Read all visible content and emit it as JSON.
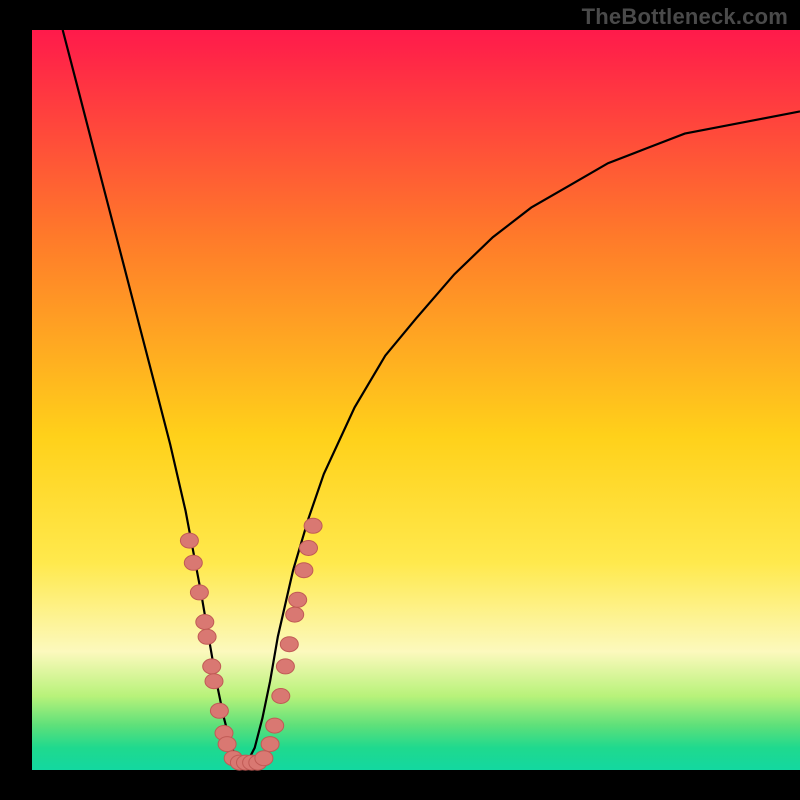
{
  "watermark": "TheBottleneck.com",
  "colors": {
    "black": "#000000",
    "watermark": "#4a4a4a",
    "curve": "#000000",
    "marker_fill": "#d97872",
    "marker_stroke": "#c05a55",
    "grad_top": "#ff1a4b",
    "grad_mid1": "#ff7a2a",
    "grad_mid2": "#ffd11a",
    "grad_yellow": "#ffe94d",
    "grad_pale": "#fcf9bd",
    "grad_green1": "#b8f27a",
    "grad_green2": "#5de07a",
    "grad_green3": "#1fd98e",
    "grad_green4": "#13d8a0"
  },
  "chart_data": {
    "type": "line",
    "title": "",
    "xlabel": "",
    "ylabel": "",
    "xlim": [
      0,
      100
    ],
    "ylim": [
      0,
      100
    ],
    "note": "Values estimated from pixel positions; curve is a V-shaped bottleneck profile reaching ~0 near x≈27, rising steeply on both sides.",
    "series": [
      {
        "name": "bottleneck-curve",
        "x": [
          4,
          6,
          8,
          10,
          12,
          14,
          16,
          18,
          20,
          22,
          23,
          24,
          25,
          26,
          27,
          28,
          29,
          30,
          31,
          32,
          34,
          36,
          38,
          42,
          46,
          50,
          55,
          60,
          65,
          70,
          75,
          80,
          85,
          90,
          95,
          100
        ],
        "y": [
          100,
          92,
          84,
          76,
          68,
          60,
          52,
          44,
          35,
          24,
          18,
          12,
          7,
          3,
          1,
          1,
          3,
          7,
          12,
          18,
          27,
          34,
          40,
          49,
          56,
          61,
          67,
          72,
          76,
          79,
          82,
          84,
          86,
          87,
          88,
          89
        ]
      }
    ],
    "markers": {
      "name": "highlight-points",
      "note": "Pink dots clustered near the valley on both arms.",
      "points": [
        {
          "x": 20.5,
          "y": 31
        },
        {
          "x": 21.0,
          "y": 28
        },
        {
          "x": 21.8,
          "y": 24
        },
        {
          "x": 22.5,
          "y": 20
        },
        {
          "x": 22.8,
          "y": 18
        },
        {
          "x": 23.4,
          "y": 14
        },
        {
          "x": 23.7,
          "y": 12
        },
        {
          "x": 24.4,
          "y": 8
        },
        {
          "x": 25.0,
          "y": 5
        },
        {
          "x": 25.4,
          "y": 3.5
        },
        {
          "x": 26.2,
          "y": 1.6
        },
        {
          "x": 27.0,
          "y": 1.0
        },
        {
          "x": 27.8,
          "y": 1.0
        },
        {
          "x": 28.6,
          "y": 1.0
        },
        {
          "x": 29.4,
          "y": 1.0
        },
        {
          "x": 30.2,
          "y": 1.6
        },
        {
          "x": 31.0,
          "y": 3.5
        },
        {
          "x": 31.6,
          "y": 6
        },
        {
          "x": 32.4,
          "y": 10
        },
        {
          "x": 33.0,
          "y": 14
        },
        {
          "x": 33.5,
          "y": 17
        },
        {
          "x": 34.2,
          "y": 21
        },
        {
          "x": 34.6,
          "y": 23
        },
        {
          "x": 35.4,
          "y": 27
        },
        {
          "x": 36.0,
          "y": 30
        },
        {
          "x": 36.6,
          "y": 33
        }
      ]
    }
  }
}
